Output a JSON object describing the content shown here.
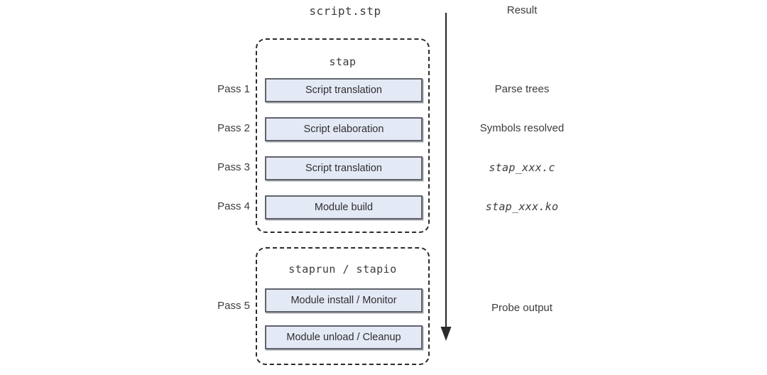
{
  "headers": {
    "script_column": "script.stp",
    "result_column": "Result"
  },
  "groups": [
    {
      "id": "stap",
      "label": "stap"
    },
    {
      "id": "staprun",
      "label": "staprun / stapio"
    }
  ],
  "passes": [
    {
      "label": "Pass 1",
      "stage": "Script translation",
      "result": "Parse trees",
      "result_mono": false
    },
    {
      "label": "Pass 2",
      "stage": "Script elaboration",
      "result": "Symbols resolved",
      "result_mono": false
    },
    {
      "label": "Pass 3",
      "stage": "Script translation",
      "result": "stap_xxx.c",
      "result_mono": true
    },
    {
      "label": "Pass 4",
      "stage": "Module build",
      "result": "stap_xxx.ko",
      "result_mono": true
    },
    {
      "label": "Pass 5",
      "stage": "Module install / Monitor",
      "result": "Probe output",
      "result_mono": false
    }
  ],
  "extra_stages": [
    {
      "stage": "Module unload / Cleanup"
    }
  ],
  "arrow": {
    "name": "downward-flow-arrow",
    "direction": "down"
  },
  "colors": {
    "box_fill": "#e4e9f6",
    "box_border": "#60636b",
    "group_border": "#2b2b2b",
    "text": "#3c3c3c",
    "arrow": "#2b2b2b",
    "background": "#ffffff"
  }
}
